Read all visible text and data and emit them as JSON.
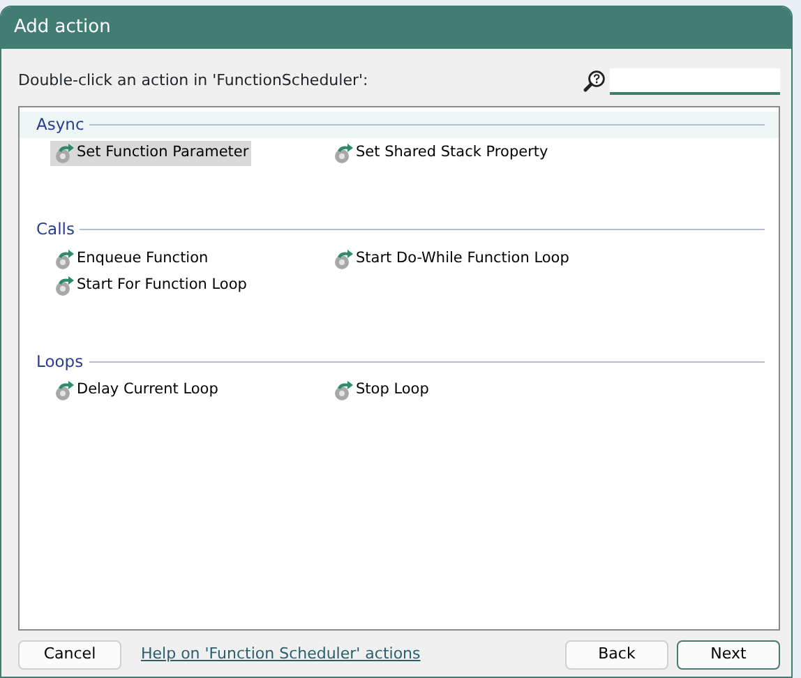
{
  "window": {
    "title": "Add action"
  },
  "prompt": "Double-click an action in 'FunctionScheduler':",
  "groups": [
    {
      "name": "Async",
      "highlighted": true,
      "actions": [
        {
          "label": "Set Function Parameter",
          "selected": true
        },
        {
          "label": "Set Shared Stack Property",
          "selected": false
        }
      ]
    },
    {
      "name": "Calls",
      "highlighted": false,
      "actions": [
        {
          "label": "Enqueue Function",
          "selected": false
        },
        {
          "label": "Start Do-While Function Loop",
          "selected": false
        },
        {
          "label": "Start For Function Loop",
          "selected": false
        }
      ]
    },
    {
      "name": "Loops",
      "highlighted": false,
      "actions": [
        {
          "label": "Delay Current Loop",
          "selected": false
        },
        {
          "label": "Stop Loop",
          "selected": false
        }
      ]
    }
  ],
  "buttons": {
    "cancel": "Cancel",
    "help_link": "Help on 'Function Scheduler' actions",
    "back": "Back",
    "next": "Next"
  }
}
